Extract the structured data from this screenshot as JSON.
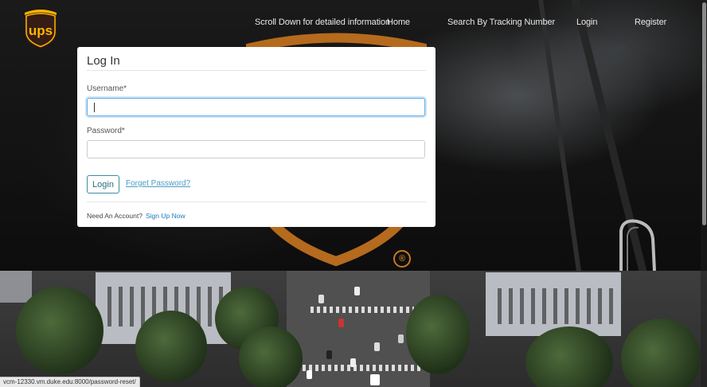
{
  "brand": {
    "logo_text": "ups"
  },
  "navbar": {
    "links": [
      {
        "label": "Scroll Down for detailed information"
      },
      {
        "label": "Home"
      },
      {
        "label": "Search By Tracking Number"
      },
      {
        "label": "Login"
      },
      {
        "label": "Register"
      }
    ]
  },
  "login_form": {
    "title": "Log In",
    "username_label": "Username*",
    "username_value": "",
    "password_label": "Password*",
    "password_value": "",
    "submit_label": "Login",
    "forgot_label": "Forget Password?",
    "need_account_text": "Need An Account?",
    "signup_label": "Sign Up Now"
  },
  "hero": {
    "registered_mark": "®"
  },
  "status_bar": {
    "url": "vcm-12330.vm.duke.edu:8000/password-reset/"
  },
  "colors": {
    "ups_brown": "#351c15",
    "ups_gold": "#ffb500",
    "focus_blue": "#66afe9",
    "link_blue": "#1a7ac0"
  }
}
